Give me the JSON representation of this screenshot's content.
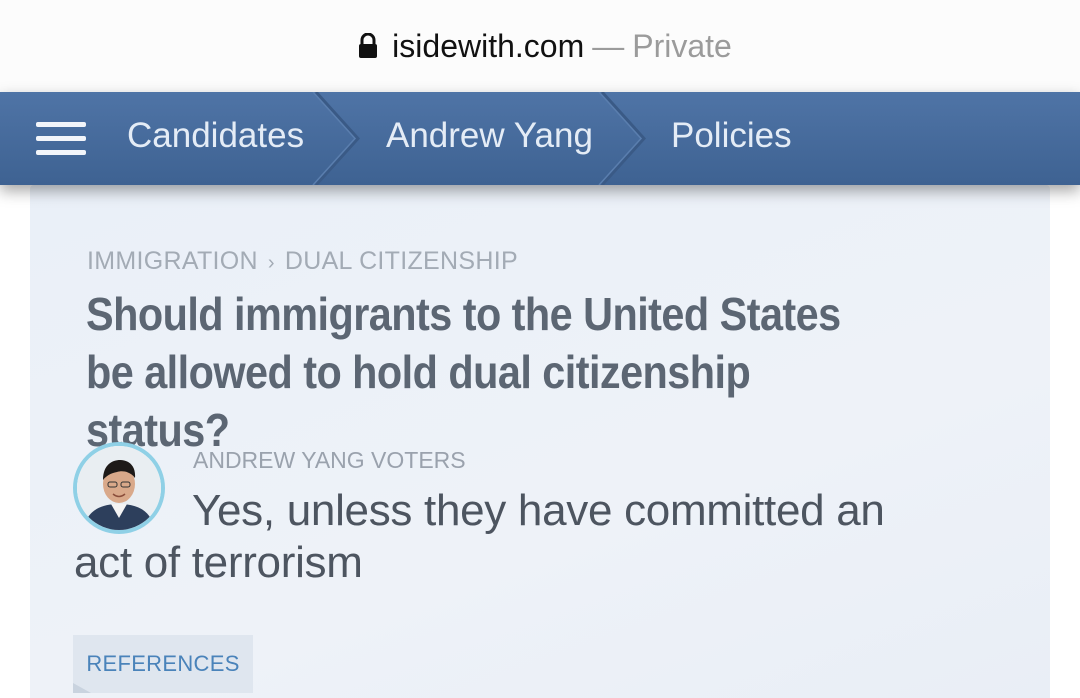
{
  "browser": {
    "domain": "isidewith.com",
    "separator": "—",
    "mode": "Private",
    "lock_icon": "lock-icon"
  },
  "nav": {
    "menu_icon": "hamburger-menu-icon",
    "crumbs": [
      {
        "label": "Candidates"
      },
      {
        "label": "Andrew Yang"
      },
      {
        "label": "Policies"
      }
    ],
    "colors": {
      "bar": "#4a6c9c",
      "text": "#e4ecf6"
    }
  },
  "topic": {
    "category": "IMMIGRATION",
    "separator": "›",
    "subcategory": "DUAL CITIZENSHIP"
  },
  "question": "Should immigrants to the United States be allowed to hold dual citizenship status?",
  "answer": {
    "source": "ANDREW YANG VOTERS",
    "text": "Yes, unless they have committed an act of terrorism",
    "avatar_icon": "avatar"
  },
  "references_label": "REFERENCES",
  "colors": {
    "accent": "#4a83ba",
    "avatar_ring": "#8fd0e6",
    "panel": "#ecf1f8"
  }
}
